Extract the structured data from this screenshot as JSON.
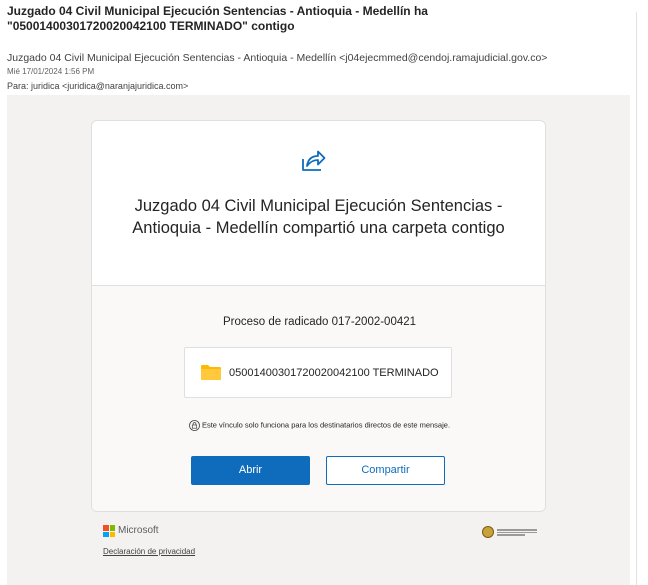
{
  "email": {
    "subject_line1": "Juzgado 04 Civil Municipal Ejecución Sentencias - Antioquia - Medellín ha",
    "subject_line2": "\"05001400301720020042100 TERMINADO\" contigo",
    "from": "Juzgado 04 Civil Municipal Ejecución Sentencias - Antioquia - Medellín <j04ejecmmed@cendoj.ramajudicial.gov.co>",
    "date": "Mié 17/01/2024 1:56 PM",
    "to": "Para:  juridica <juridica@naranjajuridica.com>"
  },
  "card": {
    "icon": "share-icon",
    "title": "Juzgado 04 Civil Municipal Ejecución Sentencias - Antioquia - Medellín compartió una carpeta contigo",
    "proceso": "Proceso de radicado 017-2002-00421",
    "folder_icon": "folder-icon",
    "folder_name": "05001400301720020042100 TERMINADO",
    "notice_icon": "lock-icon",
    "notice": "Este vínculo solo funciona para los destinatarios directos de este mensaje.",
    "open_button": "Abrir",
    "share_button": "Compartir"
  },
  "footer": {
    "brand": "Microsoft",
    "privacy_link": "Declaración de privacidad",
    "partner_logo": "rama-judicial-logo"
  },
  "colors": {
    "accent": "#0f6cbd",
    "folder": "#ffb900",
    "background": "#f3f2f1"
  }
}
